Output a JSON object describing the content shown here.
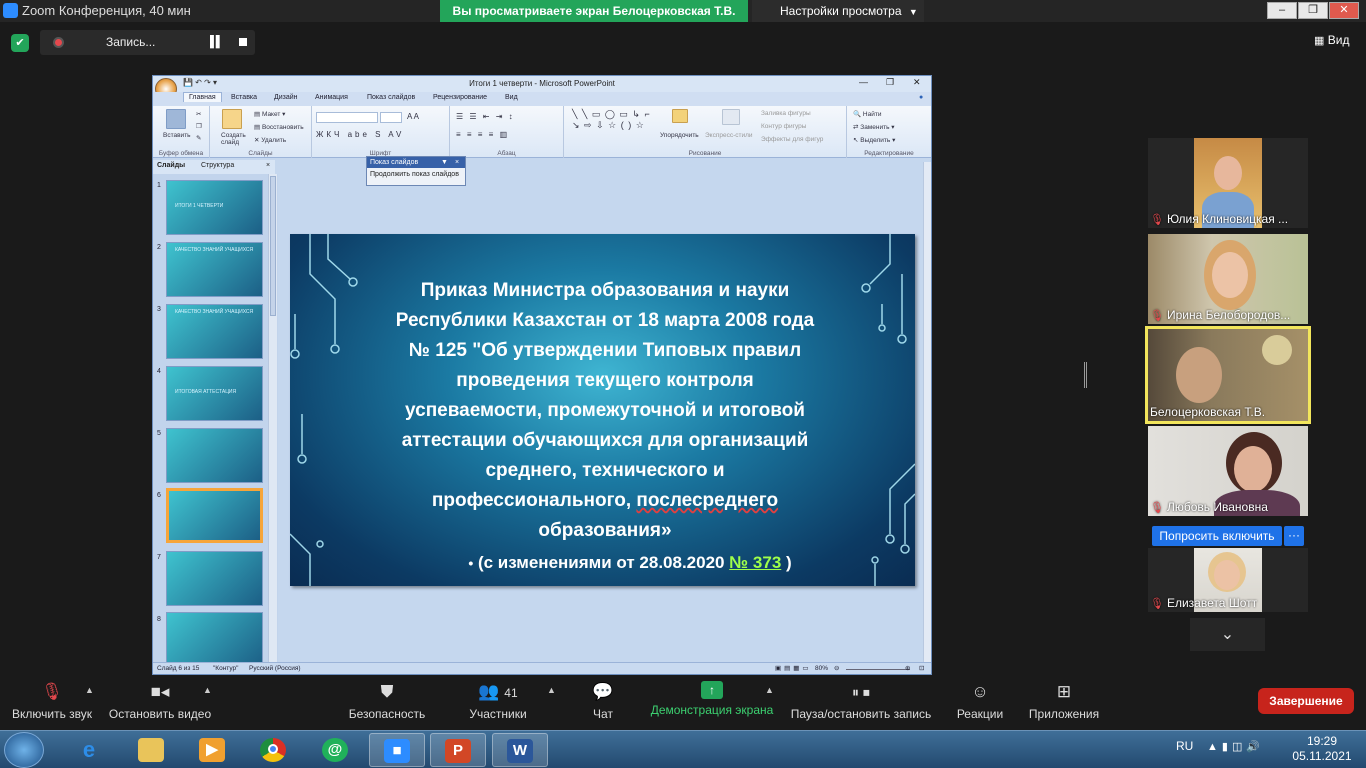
{
  "zoom": {
    "window_title": "Zoom Конференция, 40 мин",
    "viewing_banner": "Вы просматриваете экран Белоцерковская Т.В.",
    "view_settings": "Настройки просмотра",
    "recording_label": "Запись...",
    "view_button": "Вид",
    "ask_to_unmute": "Попросить включить",
    "more": "···"
  },
  "ppt": {
    "window_title": "Итоги 1 четверти - Microsoft PowerPoint",
    "tabs": [
      "Главная",
      "Вставка",
      "Дизайн",
      "Анимация",
      "Показ слайдов",
      "Рецензирование",
      "Вид"
    ],
    "ribbon": {
      "paste": "Вставить",
      "clipboard_group": "Буфер обмена",
      "new_slide": "Создать слайд",
      "layout": "Макет",
      "reset": "Восстановить",
      "delete": "Удалить",
      "slides_group": "Слайды",
      "font_group": "Шрифт",
      "paragraph_group": "Абзац",
      "arrange": "Упорядочить",
      "quick_styles": "Экспресс-стили",
      "shape_fill": "Заливка фигуры",
      "shape_outline": "Контур фигуры",
      "shape_effects": "Эффекты для фигур",
      "drawing_group": "Рисование",
      "find": "Найти",
      "replace": "Заменить",
      "select": "Выделить",
      "editing_group": "Редактирование"
    },
    "panel_tabs": [
      "Слайды",
      "Структура"
    ],
    "slideshow_panel": {
      "title": "Показ слайдов",
      "item": "Продолжить показ слайдов"
    },
    "thumbnails": [
      {
        "num": "1",
        "title": "Итоги 1 четверти"
      },
      {
        "num": "2",
        "title": "Качество знаний учащихся"
      },
      {
        "num": "3",
        "title": "Качество знаний учащихся"
      },
      {
        "num": "4",
        "title": "Итоговая аттестация"
      },
      {
        "num": "5",
        "title": ""
      },
      {
        "num": "6",
        "title": ""
      },
      {
        "num": "7",
        "title": ""
      },
      {
        "num": "8",
        "title": ""
      }
    ],
    "slide": {
      "main_lines": [
        "Приказ Министра образования и науки",
        "Республики Казахстан от 18 марта 2008 года",
        "№ 125 \"Об утверждении Типовых правил",
        "проведения текущего контроля",
        "успеваемости, промежуточной и итоговой",
        "аттестации обучающихся для организаций",
        "среднего, технического и",
        "профессионального, ",
        "послесреднего",
        "образования»"
      ],
      "sub_prefix": "(с изменениями от 28.08.2020 ",
      "sub_link": "№ 373",
      "sub_suffix": " )"
    },
    "status": {
      "slide_of": "Слайд 6 из 15",
      "theme": "\"Контур\"",
      "language": "Русский (Россия)",
      "zoom": "80%"
    }
  },
  "participants": [
    {
      "name": "Юлия Клиновицкая ...",
      "muted": true,
      "active": false
    },
    {
      "name": "Ирина Белобородов...",
      "muted": true,
      "active": false
    },
    {
      "name": "Белоцерковская Т.В.",
      "muted": false,
      "active": true
    },
    {
      "name": "Любовь Ивановна",
      "muted": true,
      "active": false
    },
    {
      "name": "Елизавета Шотт",
      "muted": true,
      "active": false
    }
  ],
  "toolbar": {
    "unmute": "Включить звук",
    "stop_video": "Остановить видео",
    "security": "Безопасность",
    "participants": "Участники",
    "participants_count": "41",
    "chat": "Чат",
    "share_screen": "Демонстрация экрана",
    "pause_record": "Пауза/остановить запись",
    "reactions": "Реакции",
    "apps": "Приложения",
    "end": "Завершение"
  },
  "taskbar": {
    "lang": "RU",
    "time": "19:29",
    "date": "05.11.2021"
  },
  "colors": {
    "zoom_green": "#23a55a",
    "end_red": "#c7241c",
    "ask_blue": "#1f72e8",
    "active_tile": "#f2e55c",
    "slide_link": "#9fff4a"
  }
}
